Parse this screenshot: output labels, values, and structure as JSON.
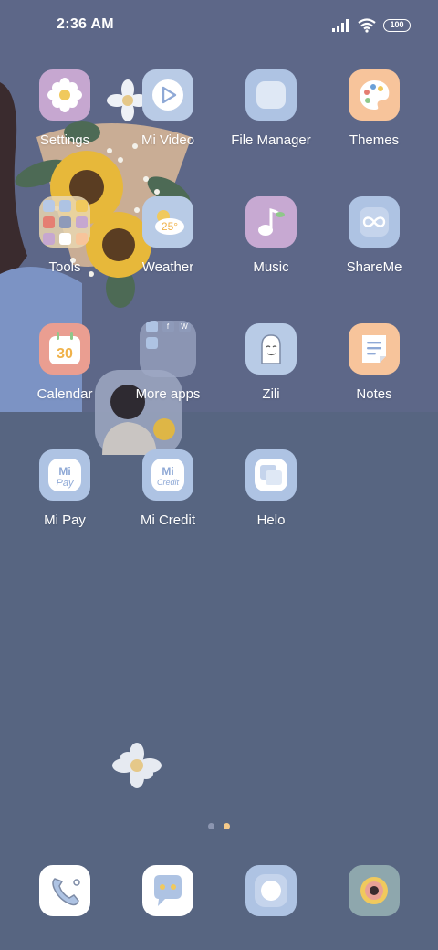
{
  "status_bar": {
    "time": "2:36 AM",
    "battery": "100",
    "icons": [
      "signal-icon",
      "wifi-icon",
      "battery-icon"
    ]
  },
  "apps": [
    {
      "label": "Settings",
      "icon": "settings-icon",
      "color": "#c6a7d0"
    },
    {
      "label": "Mi Video",
      "icon": "mi-video-icon",
      "color": "#b9cbe6"
    },
    {
      "label": "File Manager",
      "icon": "file-manager-icon",
      "color": "#aec3e3"
    },
    {
      "label": "Themes",
      "icon": "themes-icon",
      "color": "#f7c49b"
    },
    {
      "label": "Tools",
      "icon": "tools-folder-icon",
      "color": "#e9d6b0"
    },
    {
      "label": "Weather",
      "icon": "weather-icon",
      "color": "#b8cbe6"
    },
    {
      "label": "Music",
      "icon": "music-icon",
      "color": "#c7a9d2"
    },
    {
      "label": "ShareMe",
      "icon": "shareme-icon",
      "color": "#aec3e3"
    },
    {
      "label": "Calendar",
      "icon": "calendar-icon",
      "color": "#ea9e91",
      "badge": "30"
    },
    {
      "label": "More apps",
      "icon": "more-apps-folder-icon",
      "color": "#8f9ab8"
    },
    {
      "label": "Zili",
      "icon": "zili-icon",
      "color": "#b8cbe6"
    },
    {
      "label": "Notes",
      "icon": "notes-icon",
      "color": "#f7c49b"
    },
    {
      "label": "Mi Pay",
      "icon": "mi-pay-icon",
      "color": "#aec3e3",
      "brand": "Mi",
      "sub": "Pay"
    },
    {
      "label": "Mi Credit",
      "icon": "mi-credit-icon",
      "color": "#aec3e3",
      "brand": "Mi",
      "sub": "Credit"
    },
    {
      "label": "Helo",
      "icon": "helo-icon",
      "color": "#aec3e3"
    }
  ],
  "folder_more_apps": {
    "letters": [
      "f",
      "W"
    ]
  },
  "weather_temp": "25°",
  "pager": {
    "pages": 2,
    "active": 1,
    "active_color": "#f4c98a",
    "inactive_color": "#8b95b0"
  },
  "dock": [
    {
      "icon": "phone-icon",
      "color": "#ffffff"
    },
    {
      "icon": "messaging-icon",
      "color": "#ffffff"
    },
    {
      "icon": "browser-icon",
      "color": "#aec3e3"
    },
    {
      "icon": "camera-icon",
      "color": "#8ea7ad"
    }
  ]
}
